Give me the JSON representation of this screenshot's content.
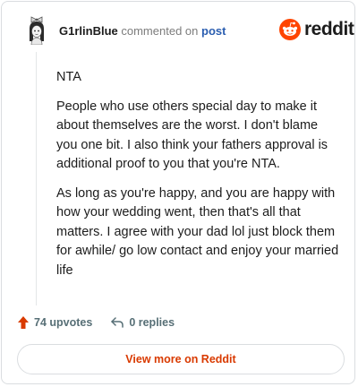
{
  "header": {
    "username": "G1rlinBlue",
    "commented_text": "commented on",
    "post_link": "post"
  },
  "logo": {
    "text": "reddit",
    "icon": "reddit-alien-icon",
    "brand_color": "#ff4500"
  },
  "comment": {
    "paragraphs": [
      "NTA",
      "People who use others special day to make it about themselves are the worst. I don't blame you one bit. I also think your fathers approval is additional proof to you that you're NTA.",
      "As long as you're happy, and you are happy with how your wedding went, then that's all that matters. I agree with your dad lol just block them for awhile/ go low contact and enjoy your married life"
    ]
  },
  "footer": {
    "upvotes": "74 upvotes",
    "replies": "0 replies",
    "upvote_icon": "upvote-arrow-icon",
    "reply_icon": "reply-arrow-icon",
    "upvote_color": "#d93a00"
  },
  "view_more": {
    "label": "View more on Reddit",
    "color": "#d93a00"
  }
}
